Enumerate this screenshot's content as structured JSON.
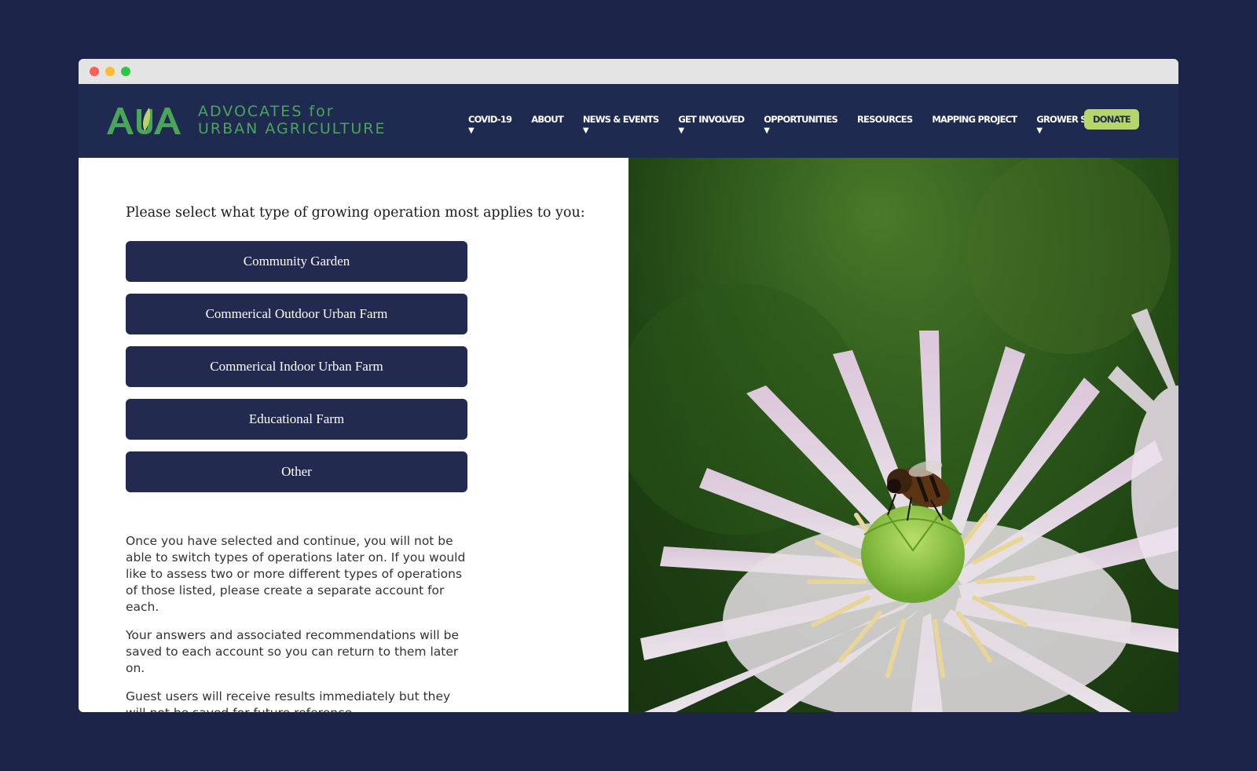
{
  "window": {
    "controls": [
      "close",
      "minimize",
      "maximize"
    ]
  },
  "header": {
    "logo_mark": "AUA",
    "logo_line1": "ADVOCATES for",
    "logo_line2": "URBAN AGRICULTURE",
    "nav": [
      {
        "label": "COVID-19",
        "caret": "▼"
      },
      {
        "label": "ABOUT",
        "caret": ""
      },
      {
        "label": "NEWS & EVENTS",
        "caret": "▼"
      },
      {
        "label": "GET INVOLVED",
        "caret": "▼"
      },
      {
        "label": "OPPORTUNITIES",
        "caret": "▼"
      },
      {
        "label": "RESOURCES",
        "caret": ""
      },
      {
        "label": "MAPPING PROJECT",
        "caret": ""
      },
      {
        "label": "GROWER SUPPORT",
        "caret": "▼"
      }
    ],
    "donate_label": "DONATE"
  },
  "main": {
    "prompt": "Please select what type of growing operation most applies to you:",
    "choices": [
      "Community Garden",
      "Commerical Outdoor Urban Farm",
      "Commerical Indoor Urban Farm",
      "Educational Farm",
      "Other"
    ],
    "notes": [
      "Once you have selected and continue, you will not be able to switch types of operations later on. If you would like to assess two or more different types of operations of those listed, please create a separate account for each.",
      "Your answers and associated recommendations will be saved to each account so you can return to them later on.",
      "Guest users will receive results immediately but they will not be saved for future reference."
    ]
  },
  "hero_image": {
    "subject": "white-poppy-with-bee"
  },
  "colors": {
    "background": "#1c244a",
    "navbar": "#1f2a50",
    "button": "#222a50",
    "logo_green": "#4aa55a",
    "donate": "#b7d56a"
  }
}
